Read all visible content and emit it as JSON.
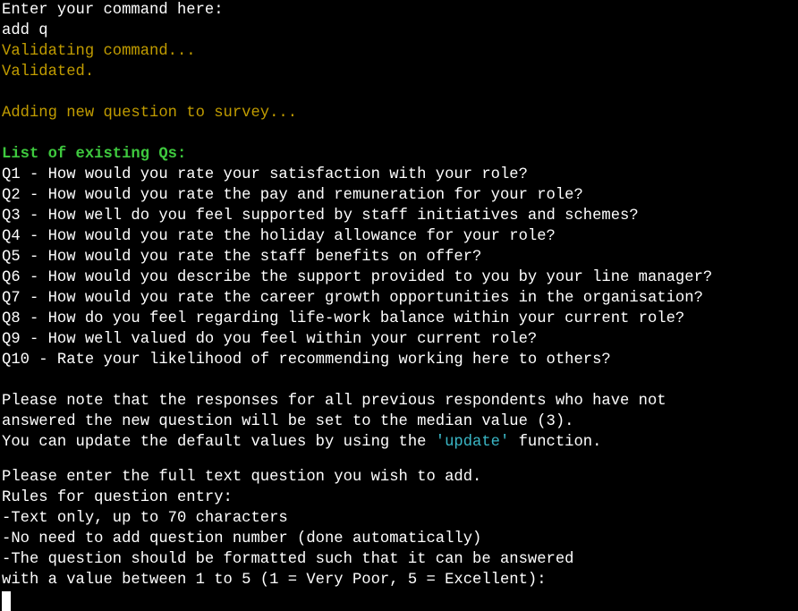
{
  "terminal": {
    "prompt": "Enter your command here:",
    "input": "add q",
    "validating": "Validating command...",
    "validated": "Validated.",
    "adding": "Adding new question to survey...",
    "list_heading": "List of existing Qs:",
    "questions": [
      "Q1 - How would you rate your satisfaction with your role?",
      "Q2 - How would you rate the pay and remuneration for your role?",
      "Q3 - How well do you feel supported by staff initiatives and schemes?",
      "Q4 - How would you rate the holiday allowance for your role?",
      "Q5 - How would you rate the staff benefits on offer?",
      "Q6 - How would you describe the support provided to you by your line manager?",
      "Q7 - How would you rate the career growth opportunities in the organisation?",
      "Q8 - How do you feel regarding life-work balance within your current role?",
      "Q9 - How well valued do you feel within your current role?",
      "Q10 - Rate your likelihood of recommending working here to others?"
    ],
    "note_line1": "Please note that the responses for all previous respondents who have not",
    "note_line2": "answered the new question will be set to the median value (3).",
    "note_line3_prefix": "You can update the default values by using the ",
    "note_line3_keyword": "'update'",
    "note_line3_suffix": " function.",
    "enter_prompt": "Please enter the full text question you wish to add.",
    "rules_heading": "Rules for question entry:",
    "rule1": "-Text only, up to 70 characters",
    "rule2": "-No need to add question number (done automatically)",
    "rule3": "-The question should be formatted such that it can be answered",
    "rule4": "with a value between 1 to 5 (1 = Very Poor, 5 = Excellent):"
  },
  "colors": {
    "background": "#000000",
    "text": "#ffffff",
    "status": "#c19c00",
    "heading": "#3ec93e",
    "keyword": "#3ab7c6"
  }
}
